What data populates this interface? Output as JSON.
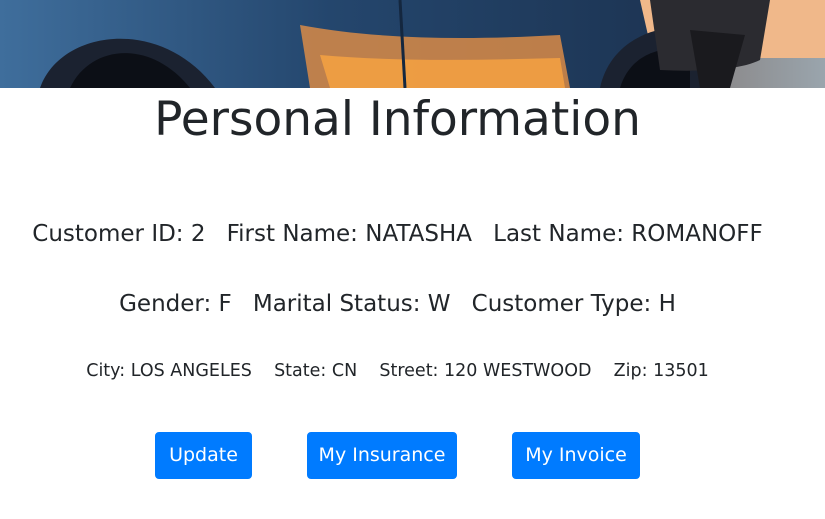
{
  "page": {
    "title": "Personal Information"
  },
  "customer": {
    "id": "Customer ID: 2",
    "first_name": "First Name: NATASHA",
    "last_name": "Last Name: ROMANOFF",
    "gender": "Gender: F",
    "marital_status": "Marital Status: W",
    "customer_type": "Customer Type: H",
    "city": "City: LOS ANGELES",
    "state": "State: CN",
    "street": "Street: 120 WESTWOOD",
    "zip": "Zip: 13501"
  },
  "actions": {
    "update_label": "Update",
    "insurance_label": "My Insurance",
    "invoice_label": "My Invoice"
  },
  "colors": {
    "primary": "#007bff",
    "text": "#212529"
  }
}
